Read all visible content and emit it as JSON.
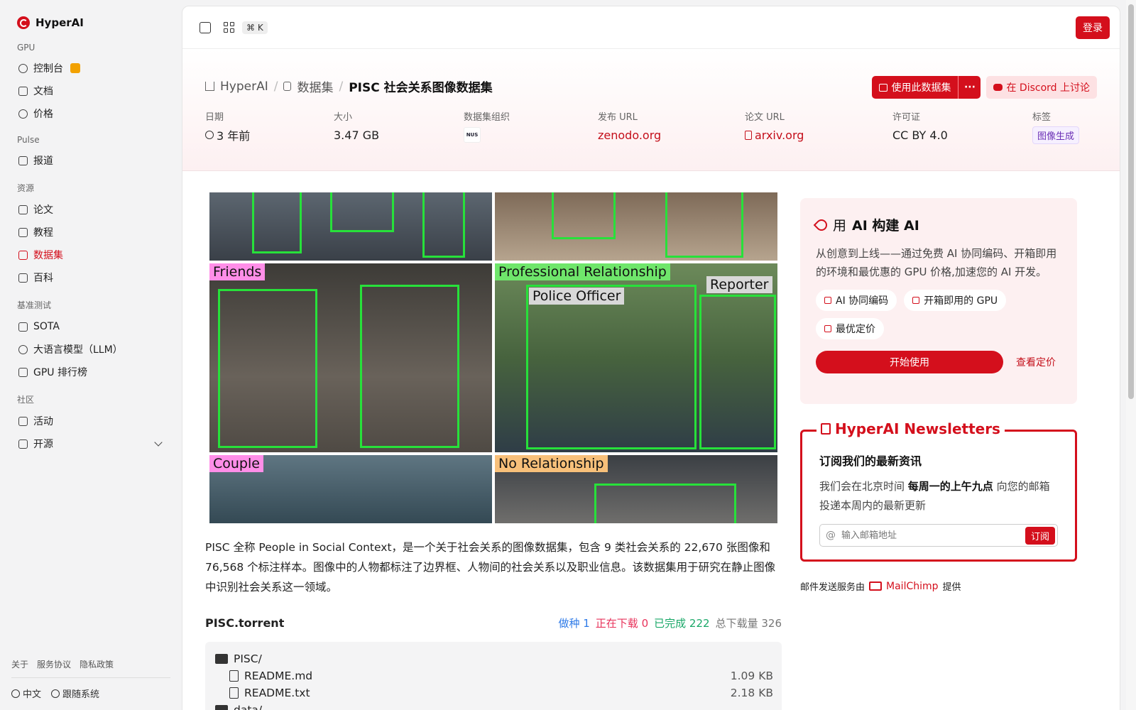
{
  "brand": {
    "name": "HyperAI"
  },
  "sidebar": {
    "sections": [
      {
        "label": "GPU",
        "items": [
          {
            "label": "控制台"
          },
          {
            "label": "文档"
          },
          {
            "label": "价格"
          }
        ]
      },
      {
        "label": "Pulse",
        "items": [
          {
            "label": "报道"
          }
        ]
      },
      {
        "label": "资源",
        "items": [
          {
            "label": "论文"
          },
          {
            "label": "教程"
          },
          {
            "label": "数据集"
          },
          {
            "label": "百科"
          }
        ]
      },
      {
        "label": "基准测试",
        "items": [
          {
            "label": "SOTA"
          },
          {
            "label": "大语言模型（LLM）"
          },
          {
            "label": "GPU 排行榜"
          }
        ]
      },
      {
        "label": "社区",
        "items": [
          {
            "label": "活动"
          },
          {
            "label": "开源"
          }
        ]
      }
    ],
    "footer_links": [
      "关于",
      "服务协议",
      "隐私政策"
    ],
    "language": "中文",
    "theme": "跟随系统"
  },
  "topbar": {
    "shortcut": "⌘ K",
    "login_label": "登录"
  },
  "breadcrumb": {
    "home": "HyperAI",
    "section": "数据集",
    "current": "PISC 社会关系图像数据集"
  },
  "actions": {
    "use_dataset": "使用此数据集",
    "more": "···",
    "discord": "在 Discord 上讨论"
  },
  "meta": {
    "date_label": "日期",
    "date_value": "3 年前",
    "size_label": "大小",
    "size_value": "3.47 GB",
    "org_label": "数据集组织",
    "org_logo_text": "NUS",
    "release_label": "发布 URL",
    "release_value": "zenodo.org",
    "paper_label": "论文 URL",
    "paper_value": "arxiv.org",
    "license_label": "许可证",
    "license_value": "CC BY 4.0",
    "tags_label": "标签",
    "tag_value": "图像生成"
  },
  "image_labels": {
    "friends": "Friends",
    "professional": "Professional Relationship",
    "police": "Police Officer",
    "reporter": "Reporter",
    "couple": "Couple",
    "no_relationship": "No Relationship"
  },
  "description": "PISC 全称 People in Social Context，是一个关于社会关系的图像数据集，包含 9 类社会关系的 22,670 张图像和 76,568 个标注样本。图像中的人物都标注了边界框、人物间的社会关系以及职业信息。该数据集用于研究在静止图像中识别社会关系这一领域。",
  "torrent": {
    "name": "PISC.torrent",
    "seed_label": "做种",
    "seed_value": "1",
    "downloading_label": "正在下载",
    "downloading_value": "0",
    "done_label": "已完成",
    "done_value": "222",
    "total_label": "总下载量",
    "total_value": "326",
    "files": [
      {
        "name": "PISC/",
        "size": "",
        "type": "folder"
      },
      {
        "name": "README.md",
        "size": "1.09 KB",
        "type": "file"
      },
      {
        "name": "README.txt",
        "size": "2.18 KB",
        "type": "file"
      },
      {
        "name": "data/",
        "size": "",
        "type": "folder"
      }
    ]
  },
  "promo": {
    "title_prefix": "用",
    "title_bold": "AI 构建 AI",
    "description": "从创意到上线——通过免费 AI 协同编码、开箱即用的环境和最优惠的 GPU 价格,加速您的 AI 开发。",
    "chips": [
      "AI 协同编码",
      "开箱即用的 GPU",
      "最优定价"
    ],
    "start_label": "开始使用",
    "pricing_label": "查看定价"
  },
  "newsletter": {
    "title": "HyperAI Newsletters",
    "subtitle": "订阅我们的最新资讯",
    "desc_prefix": "我们会在北京时间",
    "desc_bold": "每周一的上午九点",
    "desc_suffix": "向您的邮箱投递本周内的最新更新",
    "placeholder": "输入邮箱地址",
    "subscribe_label": "订阅",
    "provider_prefix": "邮件发送服务由",
    "provider_name": "MailChimp",
    "provider_suffix": "提供"
  }
}
